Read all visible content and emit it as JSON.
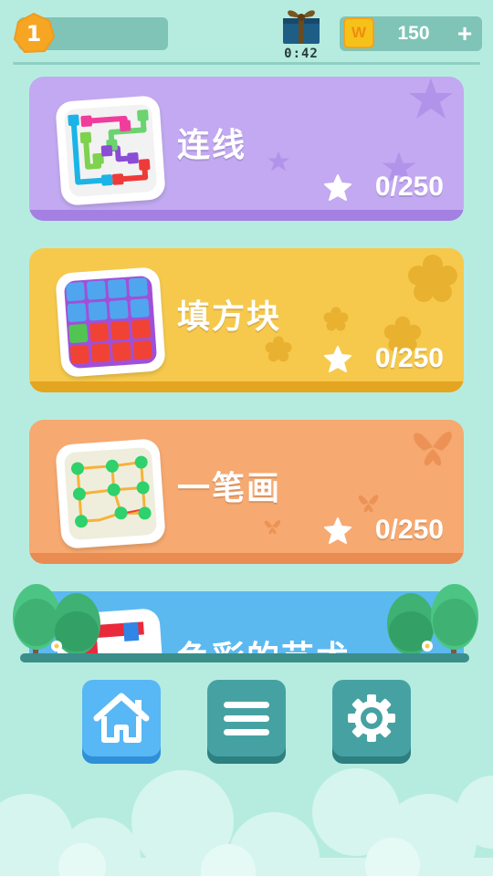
{
  "header": {
    "level": "1",
    "timer": "0:42",
    "coin_icon_letter": "W",
    "coins": "150",
    "add_coins_label": "+"
  },
  "games": [
    {
      "title": "连线",
      "score": "0/250",
      "color": "#c2a9f1",
      "icon": "line-connect-puzzle-icon"
    },
    {
      "title": "填方块",
      "score": "0/250",
      "color": "#f6c94d",
      "icon": "block-fill-puzzle-icon"
    },
    {
      "title": "一笔画",
      "score": "0/250",
      "color": "#f6a970",
      "icon": "one-stroke-puzzle-icon"
    },
    {
      "title": "色彩的艺术",
      "color": "#5bb9f0",
      "icon": "color-art-puzzle-icon"
    }
  ],
  "nav": {
    "home_icon": "home-icon",
    "menu_icon": "menu-icon",
    "settings_icon": "gear-icon"
  }
}
